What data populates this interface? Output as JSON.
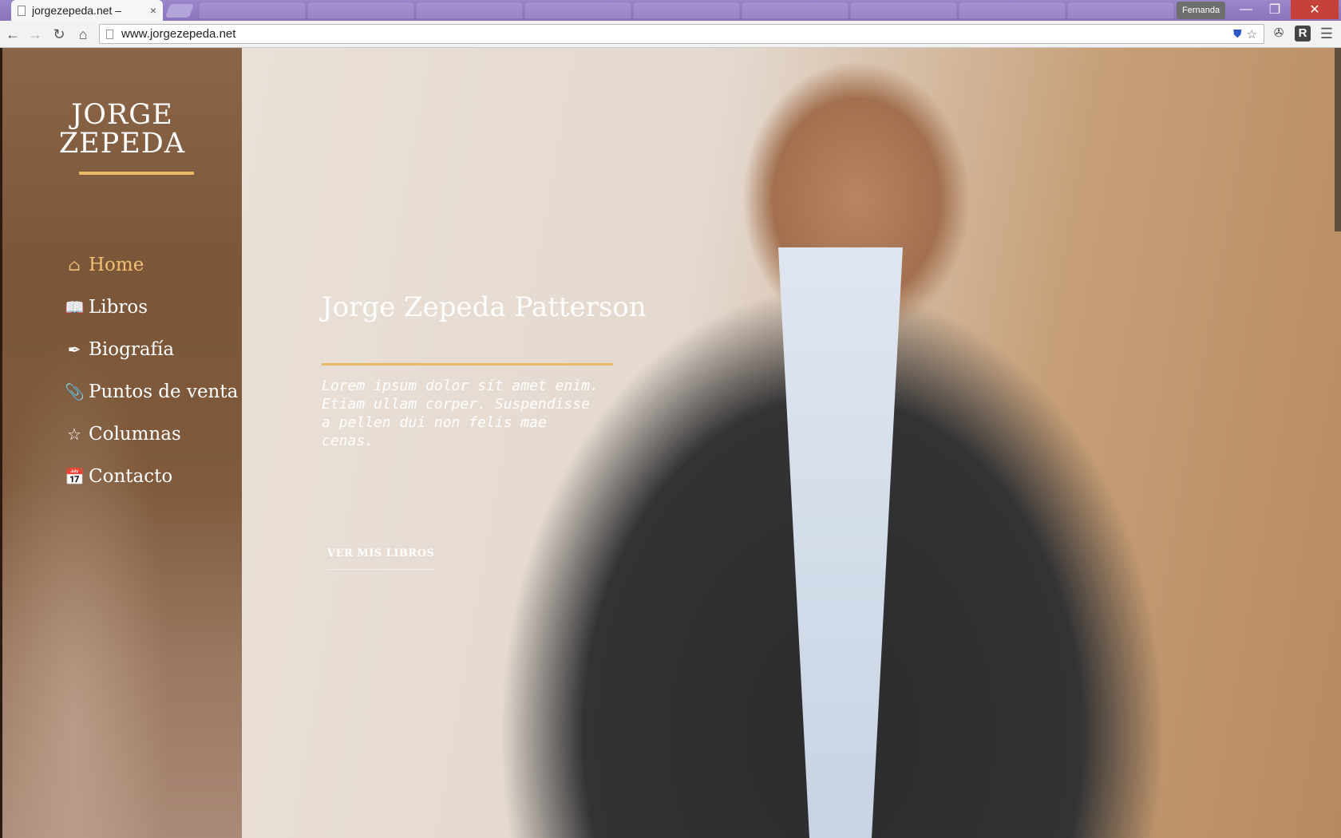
{
  "browser": {
    "tab_title": "jorgezepeda.net –",
    "tab_close": "×",
    "url": "www.jorgezepeda.net",
    "profile_name": "Fernanda",
    "window_min": "—",
    "window_max": "❐",
    "window_close": "✕",
    "nav_back": "←",
    "nav_forward": "→",
    "nav_reload": "↻",
    "nav_home": "⌂",
    "star": "☆",
    "shield": "⛊",
    "ext_puzzle": "✇",
    "ext_r": "R",
    "menu": "☰"
  },
  "site": {
    "logo_line1": "JORGE",
    "logo_line2": "ZEPEDA",
    "nav": [
      {
        "label": "Home",
        "icon": "home-icon",
        "glyph": "⌂"
      },
      {
        "label": "Libros",
        "icon": "book-icon",
        "glyph": "📖"
      },
      {
        "label": "Biografía",
        "icon": "feather-icon",
        "glyph": "✒"
      },
      {
        "label": "Puntos de venta",
        "icon": "paperclip-icon",
        "glyph": "📎"
      },
      {
        "label": "Columnas",
        "icon": "star-icon",
        "glyph": "☆"
      },
      {
        "label": "Contacto",
        "icon": "calendar-icon",
        "glyph": "📅"
      }
    ]
  },
  "hero": {
    "title": "Jorge Zepeda Patterson",
    "text": "Lorem ipsum dolor sit amet enim. Etiam ullam corper. Suspendisse a pellen dui non felis mae cenas.",
    "cta": "VER MIS LIBROS"
  },
  "colors": {
    "accent": "#e8b966",
    "active_nav": "#f0c074",
    "titlebar": "#8a74bd"
  }
}
